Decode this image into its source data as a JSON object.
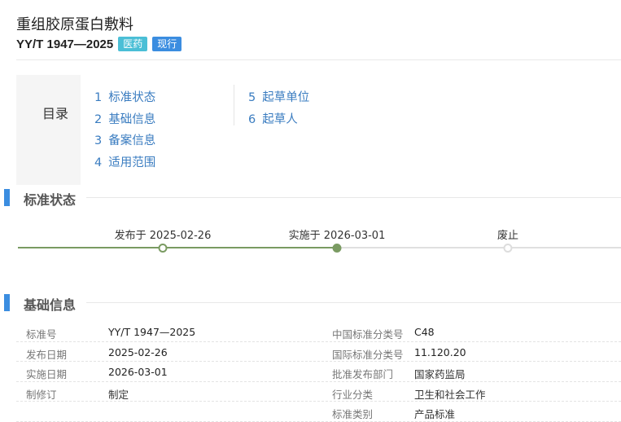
{
  "header": {
    "title": "重组胶原蛋白敷料",
    "code": "YY/T 1947—2025",
    "badges": {
      "medical": "医药",
      "current": "现行"
    }
  },
  "toc": {
    "label": "目录",
    "items": [
      {
        "num": "1",
        "label": "标准状态"
      },
      {
        "num": "2",
        "label": "基础信息"
      },
      {
        "num": "3",
        "label": "备案信息"
      },
      {
        "num": "4",
        "label": "适用范围"
      },
      {
        "num": "5",
        "label": "起草单位"
      },
      {
        "num": "6",
        "label": "起草人"
      }
    ]
  },
  "status_section": {
    "title": "标准状态",
    "timeline": [
      {
        "label": "发布于 2025-02-26",
        "state": "done"
      },
      {
        "label": "实施于 2026-03-01",
        "state": "current"
      },
      {
        "label": "废止",
        "state": "future"
      }
    ]
  },
  "basic_section": {
    "title": "基础信息",
    "rows": [
      {
        "l1": "标准号",
        "v1": "YY/T 1947—2025",
        "l2": "中国标准分类号",
        "v2": "C48"
      },
      {
        "l1": "发布日期",
        "v1": "2025-02-26",
        "l2": "国际标准分类号",
        "v2": "11.120.20"
      },
      {
        "l1": "实施日期",
        "v1": "2026-03-01",
        "l2": "批准发布部门",
        "v2": "国家药监局"
      },
      {
        "l1": "制修订",
        "v1": "制定",
        "l2": "行业分类",
        "v2": "卫生和社会工作"
      },
      {
        "l1": "",
        "v1": "",
        "l2": "标准类别",
        "v2": "产品标准"
      }
    ]
  },
  "colors": {
    "accent": "#3b8de0",
    "link": "#3a7cc0",
    "timeline_done": "#7a9b62",
    "badge_medical": "#4bbfd6",
    "badge_current": "#3b8de0"
  }
}
